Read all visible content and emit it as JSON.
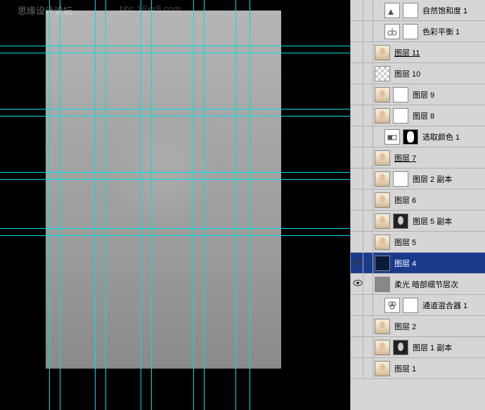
{
  "watermark1": "思缘设计论坛",
  "watermark2": "bbs.16xx8.com",
  "guides": {
    "horizontal": [
      65,
      75,
      155,
      165,
      245,
      255,
      325,
      335
    ],
    "vertical": [
      70,
      85,
      135,
      150,
      200,
      215,
      275,
      290,
      335,
      355
    ]
  },
  "layers": [
    {
      "name": "自然饱和度 1",
      "type": "adjustment",
      "visible": false,
      "indent": 1,
      "thumbs": [
        "adj-icon",
        "white"
      ],
      "icon": "vibrance"
    },
    {
      "name": "色彩平衡 1",
      "type": "adjustment",
      "visible": false,
      "indent": 1,
      "thumbs": [
        "adj-icon",
        "white"
      ],
      "icon": "balance"
    },
    {
      "name": "图层 11",
      "type": "layer",
      "visible": false,
      "indent": 0,
      "thumbs": [
        "portrait"
      ],
      "underline": true
    },
    {
      "name": "图层 10",
      "type": "layer",
      "visible": false,
      "indent": 0,
      "thumbs": [
        "checker"
      ]
    },
    {
      "name": "图层 9",
      "type": "layer",
      "visible": false,
      "indent": 0,
      "thumbs": [
        "portrait",
        "white"
      ]
    },
    {
      "name": "图层 8",
      "type": "layer",
      "visible": false,
      "indent": 0,
      "thumbs": [
        "portrait",
        "white"
      ]
    },
    {
      "name": "选取颜色 1",
      "type": "adjustment",
      "visible": false,
      "indent": 1,
      "thumbs": [
        "adj-icon",
        "black-mask"
      ],
      "icon": "selective"
    },
    {
      "name": "图层 7",
      "type": "layer",
      "visible": false,
      "indent": 0,
      "thumbs": [
        "portrait"
      ],
      "underline": true
    },
    {
      "name": "图层 2 副本",
      "type": "layer",
      "visible": false,
      "indent": 0,
      "thumbs": [
        "portrait",
        "white"
      ]
    },
    {
      "name": "图层 6",
      "type": "layer",
      "visible": false,
      "indent": 0,
      "thumbs": [
        "portrait"
      ]
    },
    {
      "name": "图层 5 副本",
      "type": "layer",
      "visible": false,
      "indent": 0,
      "thumbs": [
        "portrait",
        "bw-portrait"
      ]
    },
    {
      "name": "图层 5",
      "type": "layer",
      "visible": false,
      "indent": 0,
      "thumbs": [
        "portrait"
      ]
    },
    {
      "name": "图层 4",
      "type": "layer",
      "visible": true,
      "indent": 0,
      "thumbs": [
        "dark-blue"
      ],
      "selected": true
    },
    {
      "name": "柔光 暗部细节层次",
      "type": "layer",
      "visible": true,
      "indent": 0,
      "thumbs": [
        "gray-tex"
      ]
    },
    {
      "name": "通道混合器 1",
      "type": "adjustment",
      "visible": false,
      "indent": 1,
      "thumbs": [
        "adj-icon",
        "white"
      ],
      "icon": "mixer"
    },
    {
      "name": "图层 2",
      "type": "layer",
      "visible": false,
      "indent": 0,
      "thumbs": [
        "portrait"
      ]
    },
    {
      "name": "图层 1 副本",
      "type": "layer",
      "visible": false,
      "indent": 0,
      "thumbs": [
        "portrait",
        "bw-portrait"
      ]
    },
    {
      "name": "图层 1",
      "type": "layer",
      "visible": false,
      "indent": 0,
      "thumbs": [
        "portrait"
      ]
    }
  ]
}
